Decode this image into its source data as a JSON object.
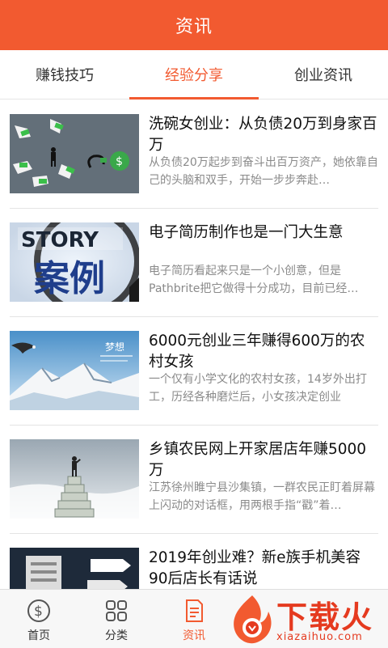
{
  "header": {
    "title": "资讯"
  },
  "tabs": [
    {
      "label": "赚钱技巧"
    },
    {
      "label": "经验分享",
      "active": true
    },
    {
      "label": "创业资讯"
    }
  ],
  "articles": [
    {
      "title": "洗碗女创业：从负债20万到身家百万",
      "summary": "从负债20万起步到奋斗出百万资产，她依靠自己的头脑和双手，开始一步步奔赴…"
    },
    {
      "title": "电子简历制作也是一门大生意",
      "summary": "电子简历看起来只是一个小创意，但是Pathbrite把它做得十分成功，目前已经…"
    },
    {
      "title": "6000元创业三年赚得600万的农村女孩",
      "summary": "一个仅有小学文化的农村女孩，14岁外出打工，历经各种磨烂后，小女孩决定创业"
    },
    {
      "title": "乡镇农民网上开家居店年赚5000万",
      "summary": "江苏徐州睢宁县沙集镇，一群农民正盯着屏幕上闪动的对话框，用两根手指“戳”着…"
    },
    {
      "title": "2019年创业难？新e族手机美容90后店长有话说",
      "summary": ""
    }
  ],
  "thumb_text": {
    "story": "STORY",
    "case": "案例",
    "dream": "梦想"
  },
  "bottom_nav": [
    {
      "label": "首页",
      "icon": "dollar-coin-icon"
    },
    {
      "label": "分类",
      "icon": "grid-icon"
    },
    {
      "label": "资讯",
      "icon": "document-icon",
      "active": true
    }
  ],
  "watermark": {
    "text": "下载火",
    "url": "xiazaihuo.com"
  },
  "colors": {
    "accent": "#f25a30",
    "logo": "#e53a1f"
  }
}
